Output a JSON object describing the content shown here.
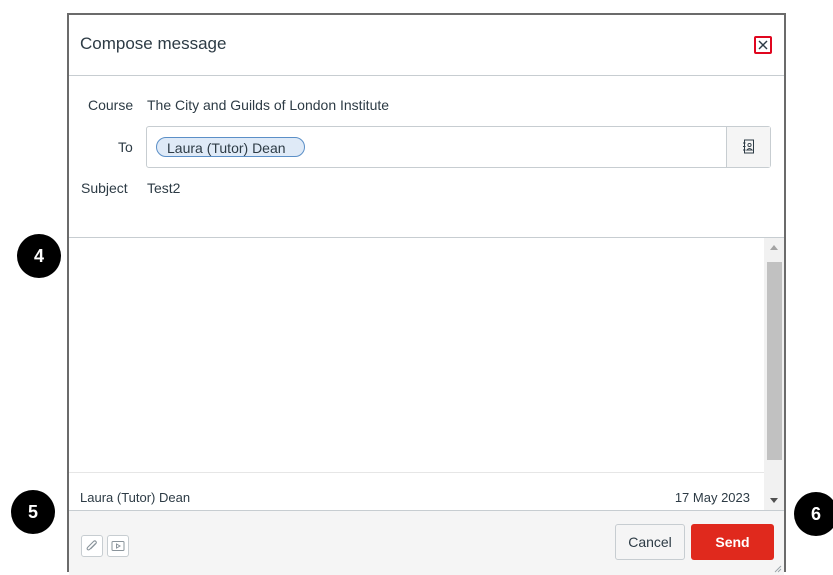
{
  "dialog": {
    "title": "Compose message",
    "close_icon": "close-icon",
    "course_label": "Course",
    "course_value": "The City and Guilds of London Institute",
    "to_label": "To",
    "recipient": "Laura (Tutor) Dean",
    "address_book_icon": "address-book-icon",
    "subject_label": "Subject",
    "subject_value": "Test2",
    "body_value": "",
    "previous_message": {
      "author": "Laura (Tutor) Dean",
      "date": "17 May 2023"
    },
    "footer": {
      "attach_icon": "paperclip-icon",
      "media_icon": "media-icon",
      "cancel_label": "Cancel",
      "send_label": "Send"
    },
    "send_color": "#e0291d"
  },
  "callouts": [
    "4",
    "5",
    "6"
  ]
}
